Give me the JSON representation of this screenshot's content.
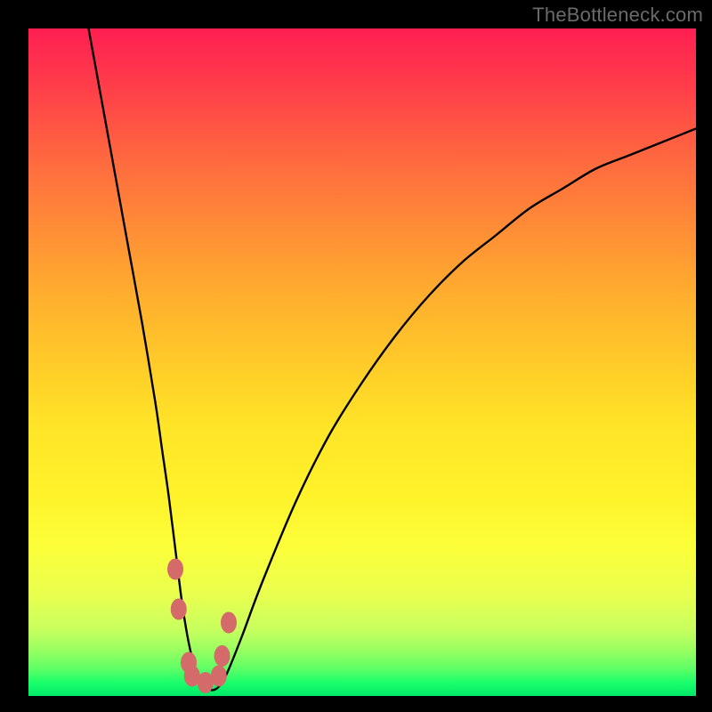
{
  "watermark": "TheBottleneck.com",
  "chart_data": {
    "type": "line",
    "title": "",
    "xlabel": "",
    "ylabel": "",
    "xlim": [
      0,
      100
    ],
    "ylim": [
      0,
      100
    ],
    "grid": false,
    "series": [
      {
        "name": "bottleneck-curve",
        "x": [
          9,
          11,
          13,
          15,
          17,
          19,
          20,
          21,
          22,
          23,
          24,
          25,
          26,
          27,
          28,
          29,
          30,
          32,
          35,
          40,
          45,
          50,
          55,
          60,
          65,
          70,
          75,
          80,
          85,
          90,
          95,
          100
        ],
        "values": [
          100,
          89,
          78,
          67,
          56,
          44,
          37,
          30,
          22,
          14,
          8,
          4,
          2,
          1,
          1,
          2,
          4,
          9,
          17,
          29,
          39,
          47,
          54,
          60,
          65,
          69,
          73,
          76,
          79,
          81,
          83,
          85
        ]
      }
    ],
    "annotations": [
      {
        "name": "trough-marker",
        "approx_x_range": [
          22,
          29
        ],
        "approx_y_range": [
          1,
          14
        ],
        "color": "#d46a6a"
      }
    ],
    "background_gradient": {
      "top": "#ff1f52",
      "mid": "#ffd028",
      "bottom": "#00e868"
    }
  }
}
